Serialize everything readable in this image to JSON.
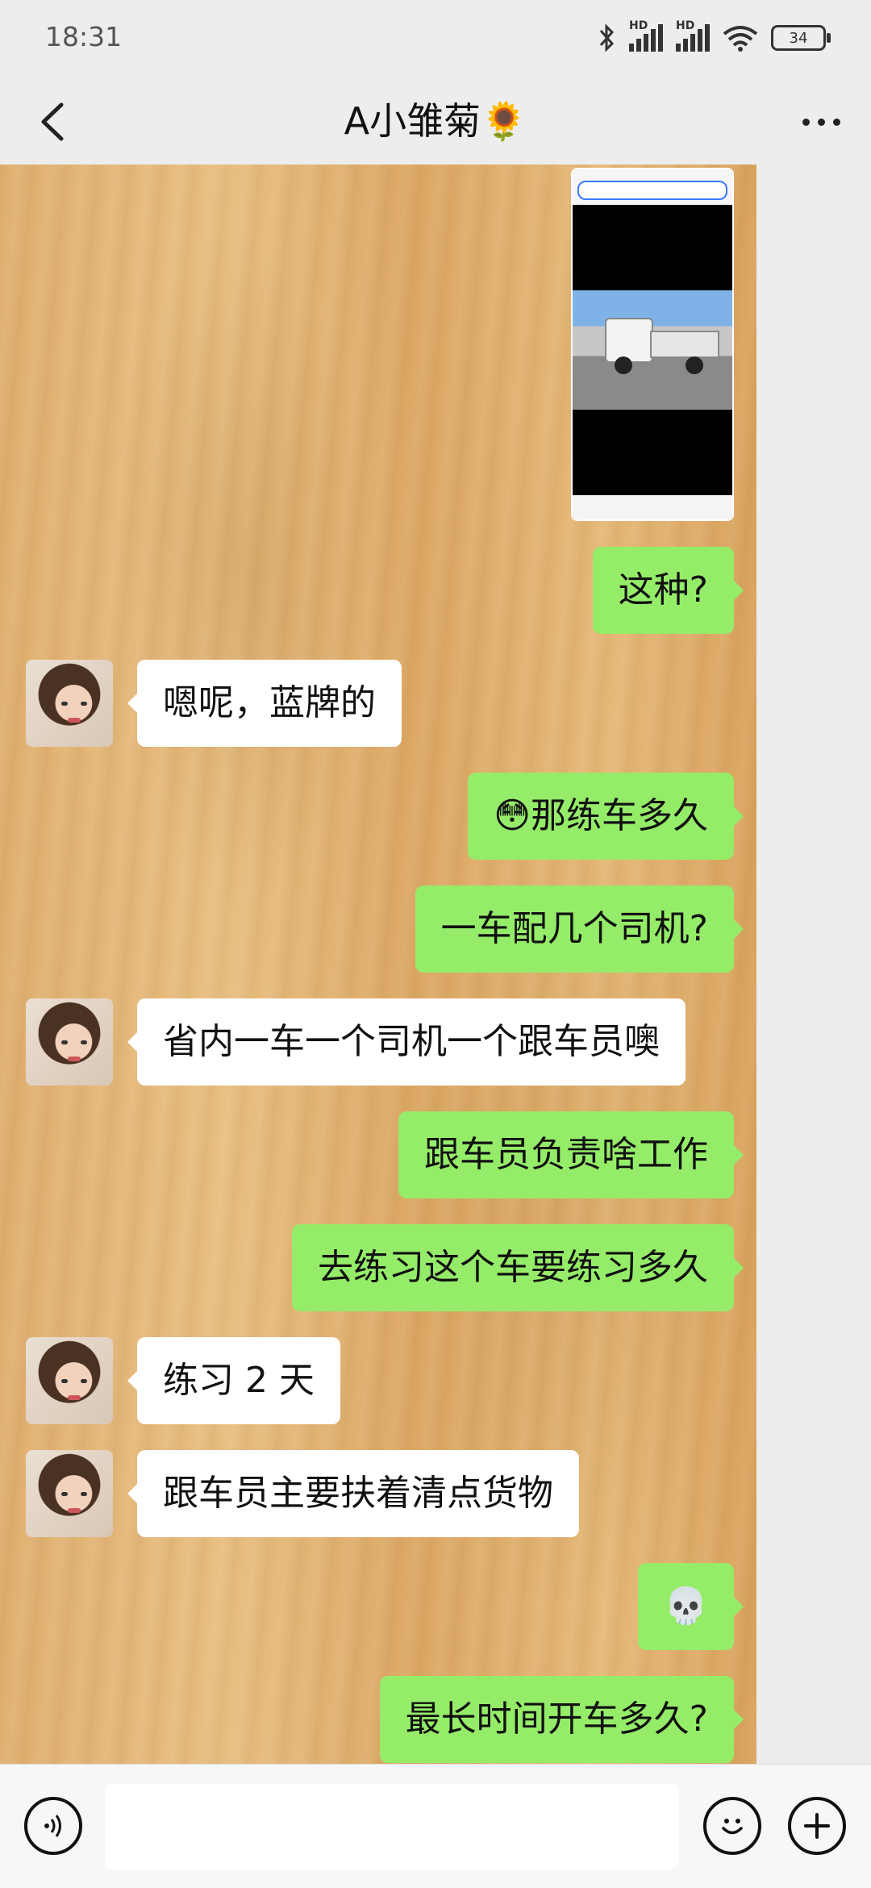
{
  "status_bar": {
    "time": "18:31",
    "battery": "34",
    "signal_label": "HD"
  },
  "header": {
    "title": "A小雏菊🌻",
    "back_icon": "chevron-left-icon",
    "more_icon": "more-dots-icon"
  },
  "chat": {
    "messages": [
      {
        "side": "out",
        "type": "image",
        "description_icon": "truck-screenshot-image"
      },
      {
        "side": "out",
        "text": "这种?"
      },
      {
        "side": "in",
        "text": "嗯呢，蓝牌的"
      },
      {
        "side": "out",
        "text": "😳那练车多久"
      },
      {
        "side": "out",
        "text": "一车配几个司机?"
      },
      {
        "side": "in",
        "text": "省内一车一个司机一个跟车员噢"
      },
      {
        "side": "out",
        "text": "跟车员负责啥工作"
      },
      {
        "side": "out",
        "text": "去练习这个车要练习多久"
      },
      {
        "side": "in",
        "text": "练习 2 天"
      },
      {
        "side": "in",
        "text": "跟车员主要扶着清点货物"
      },
      {
        "side": "out",
        "text": "💀"
      },
      {
        "side": "out",
        "text": "最长时间开车多久?"
      }
    ]
  },
  "input_bar": {
    "voice_icon": "voice-icon",
    "emoji_icon": "emoji-icon",
    "plus_icon": "plus-icon",
    "input_value": ""
  },
  "colors": {
    "outgoing_bubble": "#95ec69",
    "incoming_bubble": "#ffffff",
    "background": "#ededed"
  }
}
